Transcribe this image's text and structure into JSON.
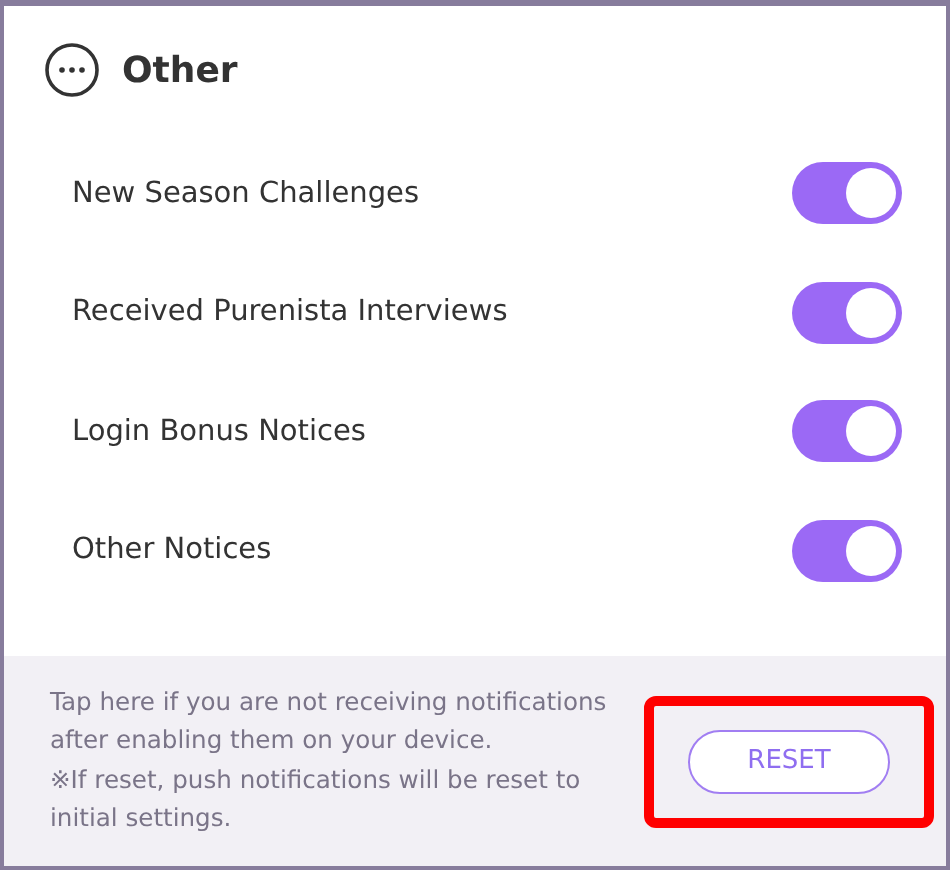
{
  "section": {
    "title": "Other"
  },
  "settings": [
    {
      "label": "New Season Challenges",
      "on": true
    },
    {
      "label": "Received Purenista Interviews",
      "on": true
    },
    {
      "label": "Login Bonus Notices",
      "on": true
    },
    {
      "label": "Other Notices",
      "on": true
    }
  ],
  "footer": {
    "lines": [
      "Tap here if you are not receiving notifications",
      "after enabling them on your device.",
      "※If reset, push notifications will be reset to",
      "initial settings."
    ],
    "button": "RESET",
    "highlighted": true
  }
}
